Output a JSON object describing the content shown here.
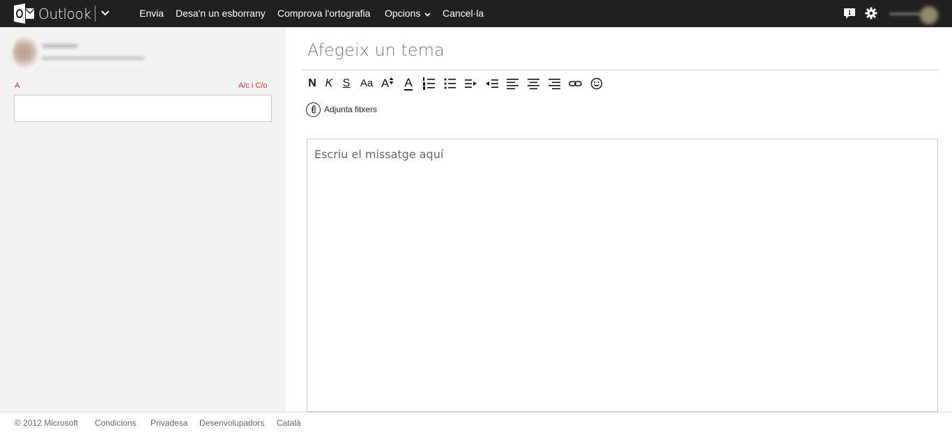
{
  "app": {
    "name": "Outlook"
  },
  "colors": {
    "topbar": "#202020",
    "accent_red": "#d13438",
    "left_pane": "#f3f3f3"
  },
  "commands": {
    "send": "Envia",
    "save_draft": "Desa'n un esborrany",
    "spell_check": "Comprova l'ortografia",
    "options": "Opcions",
    "cancel": "Cancel·la"
  },
  "top_icons": [
    "feedback-icon",
    "gear-icon"
  ],
  "compose": {
    "to_label": "A",
    "cc_bcc_label": "A/c i C/o",
    "to_value": "",
    "subject_placeholder": "Afegeix un tema",
    "body_placeholder": "Escriu el missatge aquí",
    "attach_label": "Adjunta fitxers"
  },
  "toolbar": {
    "bold": "N",
    "italic": "K",
    "underline": "S",
    "font_size": "Aa",
    "grow_font": "A",
    "font_color": "A",
    "buttons": [
      "bold-icon",
      "italic-icon",
      "underline-icon",
      "font-size-icon",
      "grow-font-icon",
      "font-color-icon",
      "numbered-list-icon",
      "bulleted-list-icon",
      "indent-icon",
      "outdent-icon",
      "align-left-icon",
      "align-center-icon",
      "align-right-icon",
      "link-icon",
      "emoticon-icon"
    ]
  },
  "footer": {
    "copyright": "© 2012 Microsoft",
    "terms": "Condicions",
    "privacy": "Privadesa",
    "developers": "Desenvolupadors",
    "language": "Català"
  }
}
